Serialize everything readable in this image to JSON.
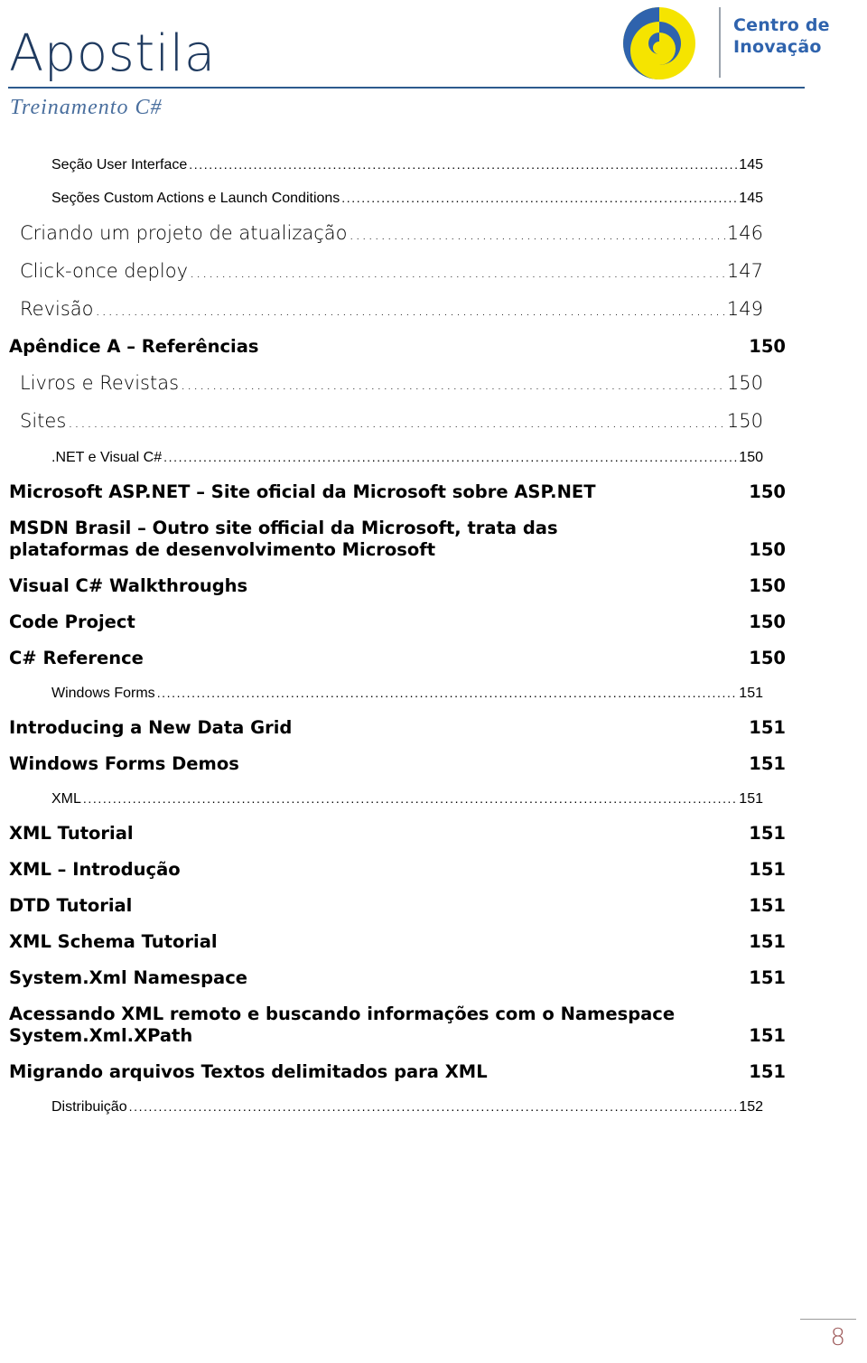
{
  "header": {
    "title": "Apostila",
    "subtitle": "Treinamento C#",
    "rule_color": "#2d5a8e",
    "title_color": "#1f3a5f",
    "subtitle_color": "#4a6f9e"
  },
  "logo": {
    "mark_name": "spiral-logo",
    "mark_colors": {
      "outer": "#f5e400",
      "spiral": "#2f63ad"
    },
    "line1": "Centro de",
    "line2": "Inovação",
    "text_color": "#2f63ad"
  },
  "toc": {
    "entries": [
      {
        "level": 3,
        "label": "Seção User Interface",
        "page": "145",
        "leader": true
      },
      {
        "level": 3,
        "label": "Seções Custom Actions e Launch Conditions",
        "page": "145",
        "leader": true
      },
      {
        "level": 2,
        "label": "Criando um projeto de atualização",
        "page": "146",
        "leader": true
      },
      {
        "level": 2,
        "label": "Click-once deploy",
        "page": "147",
        "leader": true
      },
      {
        "level": 2,
        "label": "Revisão",
        "page": "149",
        "leader": true
      },
      {
        "level": 1,
        "label": "Apêndice A – Referências",
        "page": "150",
        "leader": false
      },
      {
        "level": 2,
        "label": "Livros e Revistas",
        "page": "150",
        "leader": true
      },
      {
        "level": 2,
        "label": "Sites",
        "page": "150",
        "leader": true
      },
      {
        "level": 3,
        "label": ".NET e Visual C#",
        "page": "150",
        "leader": true
      },
      {
        "level": 1,
        "label": "Microsoft ASP.NET – Site oficial da Microsoft sobre ASP.NET",
        "page": "150",
        "leader": false
      },
      {
        "level": 1,
        "label": "MSDN Brasil – Outro site official da Microsoft, trata das plataformas de desenvolvimento Microsoft",
        "page": "150",
        "leader": false,
        "two_line": true
      },
      {
        "level": 1,
        "label": "Visual C# Walkthroughs",
        "page": "150",
        "leader": false
      },
      {
        "level": 1,
        "label": "Code Project",
        "page": "150",
        "leader": false
      },
      {
        "level": 1,
        "label": "C# Reference",
        "page": "150",
        "leader": false
      },
      {
        "level": 3,
        "label": "Windows Forms",
        "page": "151",
        "leader": true
      },
      {
        "level": 1,
        "label": "Introducing a New Data Grid",
        "page": "151",
        "leader": false
      },
      {
        "level": 1,
        "label": "Windows Forms Demos",
        "page": "151",
        "leader": false
      },
      {
        "level": 3,
        "label": "XML",
        "page": "151",
        "leader": true
      },
      {
        "level": 1,
        "label": "XML Tutorial",
        "page": "151",
        "leader": false
      },
      {
        "level": 1,
        "label": "XML – Introdução",
        "page": "151",
        "leader": false
      },
      {
        "level": 1,
        "label": "DTD Tutorial",
        "page": "151",
        "leader": false
      },
      {
        "level": 1,
        "label": "XML Schema Tutorial",
        "page": "151",
        "leader": false
      },
      {
        "level": 1,
        "label": "System.Xml Namespace",
        "page": "151",
        "leader": false
      },
      {
        "level": 1,
        "label": "Acessando XML remoto e buscando informações com o Namespace System.Xml.XPath",
        "page": "151",
        "leader": false,
        "two_line": true
      },
      {
        "level": 1,
        "label": "Migrando arquivos Textos delimitados para XML",
        "page": "151",
        "leader": false
      },
      {
        "level": 3,
        "label": "Distribuição",
        "page": "152",
        "leader": true
      }
    ],
    "leader_char": "."
  },
  "footer": {
    "page_number": "8",
    "page_number_color": "#9e5a5a",
    "rule_color": "#9b9b9b"
  }
}
